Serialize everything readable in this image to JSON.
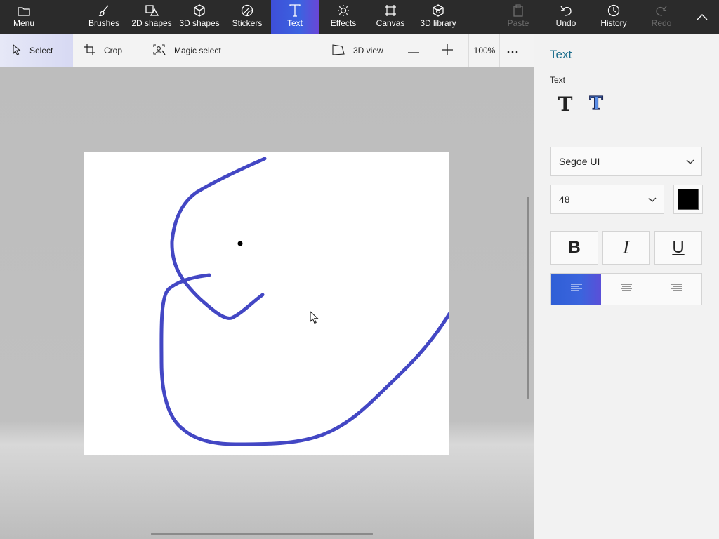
{
  "ribbon": {
    "menu": "Menu",
    "brushes": "Brushes",
    "shapes2d": "2D shapes",
    "shapes3d": "3D shapes",
    "stickers": "Stickers",
    "text": "Text",
    "effects": "Effects",
    "canvas": "Canvas",
    "library3d": "3D library",
    "paste": "Paste",
    "undo": "Undo",
    "history": "History",
    "redo": "Redo",
    "active_tab": "Text"
  },
  "commandbar": {
    "select": "Select",
    "crop": "Crop",
    "magic_select": "Magic select",
    "view3d": "3D view",
    "zoom": "100%"
  },
  "panel": {
    "title": "Text",
    "section_label": "Text",
    "font": "Segoe UI",
    "size": "48",
    "color": "#000000",
    "bold": "B",
    "italic": "I",
    "underline": "U",
    "alignment_selected": "left"
  },
  "colors": {
    "accent": "#3e4fd8",
    "stroke": "#4347c4",
    "panel_title": "#1b6d8c"
  }
}
